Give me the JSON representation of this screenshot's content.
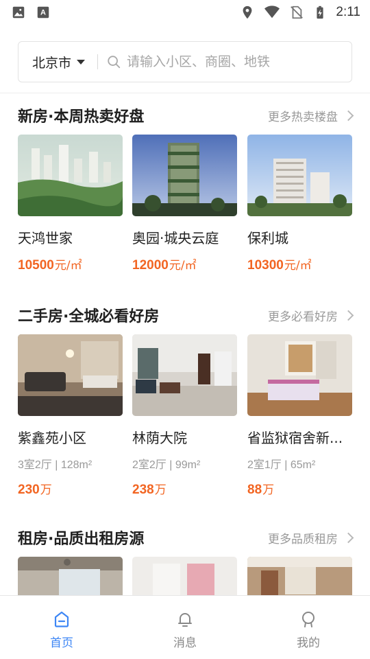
{
  "status_bar": {
    "time": "2:11"
  },
  "search": {
    "city": "北京市",
    "placeholder": "请输入小区、商圈、地铁"
  },
  "colors": {
    "accent": "#3d86f5",
    "price": "#f26522"
  },
  "new_homes": {
    "title": "新房·本周热卖好盘",
    "more": "更多热卖楼盘",
    "items": [
      {
        "name": "天鸿世家",
        "price": "10500",
        "unit": "元/㎡"
      },
      {
        "name": "奥园·城央云庭",
        "price": "12000",
        "unit": "元/㎡"
      },
      {
        "name": "保利城",
        "price": "10300",
        "unit": "元/㎡"
      }
    ]
  },
  "second_hand": {
    "title": "二手房·全城必看好房",
    "more": "更多必看好房",
    "items": [
      {
        "name": "紫鑫苑小区",
        "meta": "3室2厅 | 128m²",
        "price": "230",
        "unit": "万"
      },
      {
        "name": "林荫大院",
        "meta": "2室2厅 | 99m²",
        "price": "238",
        "unit": "万"
      },
      {
        "name": "省监狱宿舍新...",
        "meta": "2室1厅 | 65m²",
        "price": "88",
        "unit": "万"
      }
    ]
  },
  "rentals": {
    "title": "租房·品质出租房源",
    "more": "更多品质租房"
  },
  "bottom_nav": {
    "items": [
      {
        "label": "首页",
        "icon": "home-icon",
        "active": true
      },
      {
        "label": "消息",
        "icon": "bell-icon",
        "active": false
      },
      {
        "label": "我的",
        "icon": "profile-icon",
        "active": false
      }
    ]
  }
}
